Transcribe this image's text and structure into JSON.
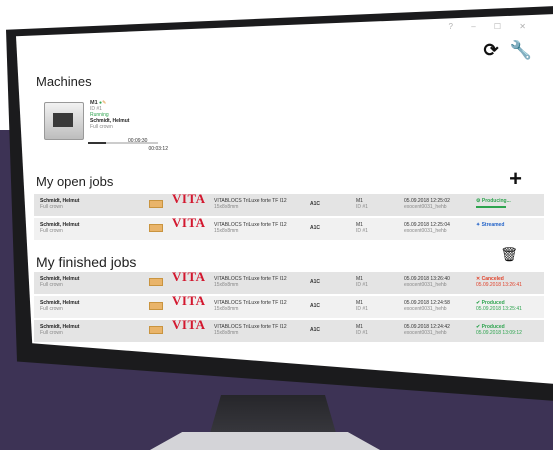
{
  "window": {
    "controls": "? – ☐ ✕"
  },
  "toolbar": {
    "refresh_icon": "refresh-icon",
    "settings_icon": "wrench-icon"
  },
  "sections": {
    "machines": "Machines",
    "open_jobs": "My open jobs",
    "finished_jobs": "My finished jobs"
  },
  "machine": {
    "name": "M1",
    "id": "ID #1",
    "status": "Running",
    "customer": "Schmidt, Helmut",
    "restoration": "Full crown",
    "elapsed": "00:03:12",
    "remaining": "00:09:30",
    "progress_fraction": 0.25
  },
  "open_jobs": [
    {
      "customer": "Schmidt, Helmut",
      "restoration": "Full crown",
      "brand": "VITA",
      "material": "VITABLOCS TriLuxe forte TF I12",
      "size": "15x8x8mm",
      "shade": "A1C",
      "machine": "M1",
      "machine_id": "ID #1",
      "date": "05.09.2018 12:25:02",
      "file": "exocent0031_hehb",
      "status": "Producing...",
      "status_color": "#2ea44f",
      "status_icon": "gear-icon",
      "status_sub": ""
    },
    {
      "customer": "Schmidt, Helmut",
      "restoration": "Full crown",
      "brand": "VITA",
      "material": "VITABLOCS TriLuxe forte TF I12",
      "size": "15x8x8mm",
      "shade": "A1C",
      "machine": "M1",
      "machine_id": "ID #1",
      "date": "05.09.2018 12:25:04",
      "file": "exocent0031_hehb",
      "status": "Streamed",
      "status_color": "#2464c9",
      "status_icon": "wand-icon",
      "status_sub": ""
    }
  ],
  "finished_jobs": [
    {
      "customer": "Schmidt, Helmut",
      "restoration": "Full crown",
      "brand": "VITA",
      "material": "VITABLOCS TriLuxe forte TF I12",
      "size": "15x8x8mm",
      "shade": "A1C",
      "machine": "M1",
      "machine_id": "ID #1",
      "date": "05.09.2018 13:26:40",
      "file": "exocent0031_hehb",
      "status": "Canceled",
      "status_color": "#e0422b",
      "status_icon": "x-icon",
      "status_sub": "05.09.2018 13:26:41"
    },
    {
      "customer": "Schmidt, Helmut",
      "restoration": "Full crown",
      "brand": "VITA",
      "material": "VITABLOCS TriLuxe forte TF I12",
      "size": "15x8x8mm",
      "shade": "A1C",
      "machine": "M1",
      "machine_id": "ID #1",
      "date": "05.09.2018 12:24:58",
      "file": "exocent0031_hehb",
      "status": "Produced",
      "status_color": "#2ea44f",
      "status_icon": "check-icon",
      "status_sub": "05.09.2018 13:25:41"
    },
    {
      "customer": "Schmidt, Helmut",
      "restoration": "Full crown",
      "brand": "VITA",
      "material": "VITABLOCS TriLuxe forte TF I12",
      "size": "15x8x8mm",
      "shade": "A1C",
      "machine": "M1",
      "machine_id": "ID #1",
      "date": "05.09.2018 12:24:42",
      "file": "exocent0031_hehb",
      "status": "Produced",
      "status_color": "#2ea44f",
      "status_icon": "check-icon",
      "status_sub": "05.09.2018 13:09:12"
    }
  ]
}
